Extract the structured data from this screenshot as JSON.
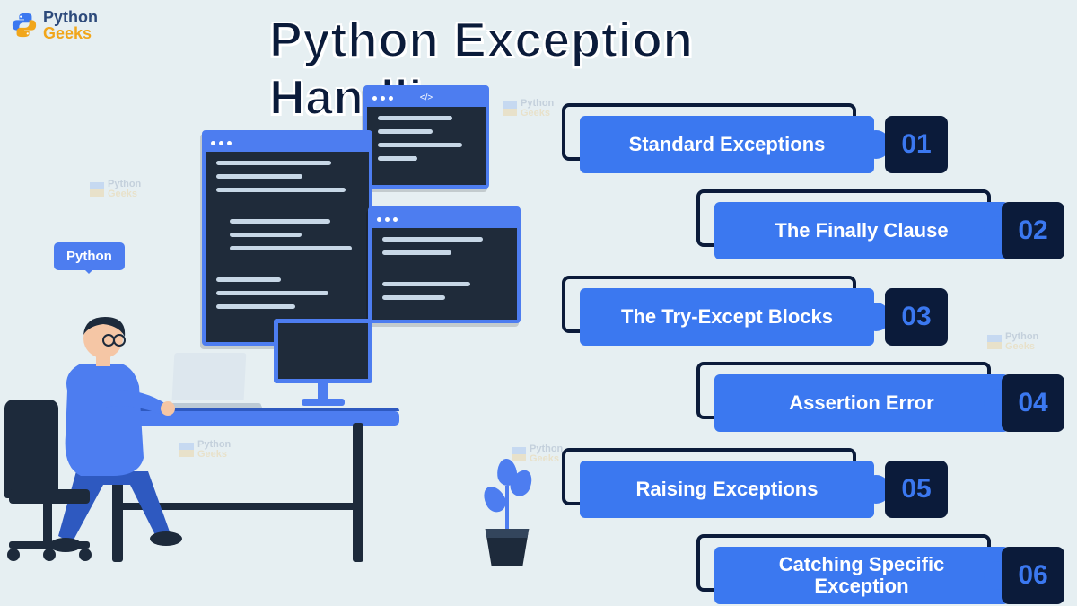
{
  "brand": {
    "name_line1": "Python",
    "name_line2": "Geeks"
  },
  "title": "Python Exception Handling",
  "speech_bubble": "Python",
  "watermark": {
    "line1": "Python",
    "line2": "Geeks"
  },
  "list_items": [
    {
      "label": "Standard Exceptions",
      "number": "01"
    },
    {
      "label": "The Finally Clause",
      "number": "02"
    },
    {
      "label": "The Try-Except Blocks",
      "number": "03"
    },
    {
      "label": "Assertion Error",
      "number": "04"
    },
    {
      "label": "Raising Exceptions",
      "number": "05"
    },
    {
      "label": "Catching Specific Exception",
      "number": "06"
    }
  ],
  "colors": {
    "background": "#e6eff2",
    "primary_blue": "#3b78f0",
    "dark_navy": "#0b1b3a",
    "code_bg": "#1f2b3a",
    "brand_orange": "#f1a61b"
  }
}
